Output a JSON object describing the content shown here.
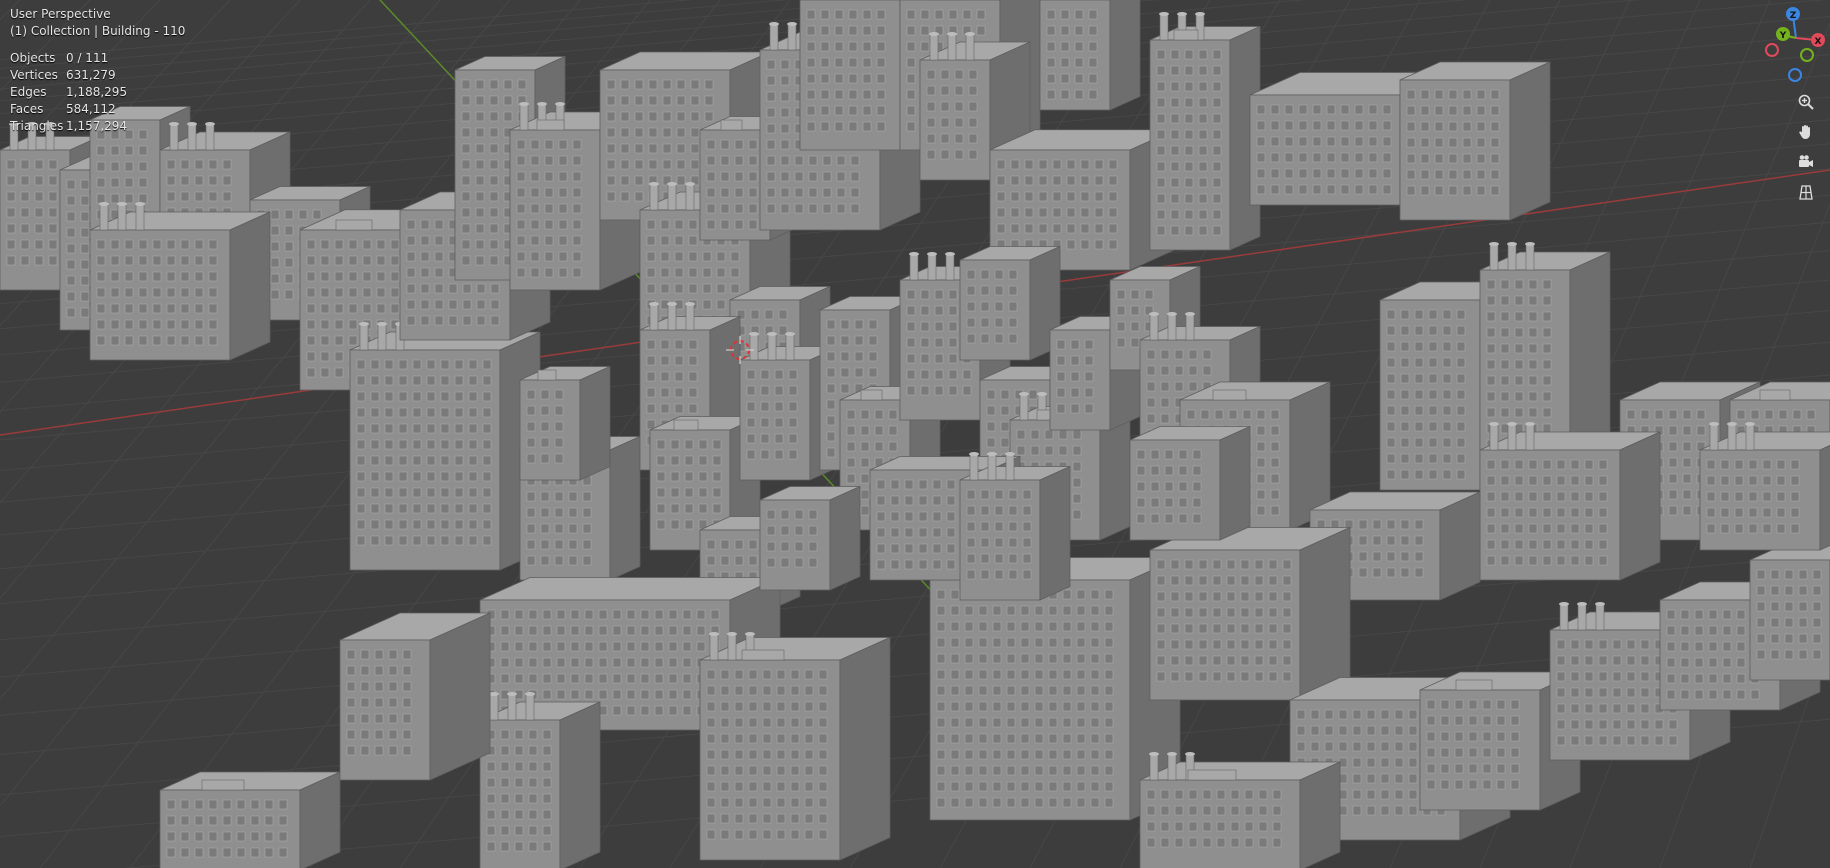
{
  "viewport": {
    "view_name": "User Perspective",
    "collection_info": "(1) Collection | Building - 110",
    "stats": [
      {
        "label": "Objects",
        "value": "0 / 111"
      },
      {
        "label": "Vertices",
        "value": "631,279"
      },
      {
        "label": "Edges",
        "value": "1,188,295"
      },
      {
        "label": "Faces",
        "value": "584,112"
      },
      {
        "label": "Triangles",
        "value": "1,157,294"
      }
    ]
  },
  "gizmo": {
    "z_label": "Z",
    "y_label": "Y",
    "x_label": "X",
    "colors": {
      "x": "#e04a5a",
      "y": "#74b21e",
      "z": "#3b86e0"
    }
  },
  "navigation_tools": [
    {
      "name": "zoom-icon"
    },
    {
      "name": "pan-hand-icon"
    },
    {
      "name": "camera-icon"
    },
    {
      "name": "grid-ortho-icon"
    }
  ],
  "colors": {
    "background": "#3d3d3d",
    "grid": "#474747",
    "x_axis": "#9a3b3b",
    "y_axis": "#5b8a2a",
    "building_light": "#a8a8a8",
    "building_mid": "#8f8f8f",
    "building_dark": "#6e6e6e"
  }
}
